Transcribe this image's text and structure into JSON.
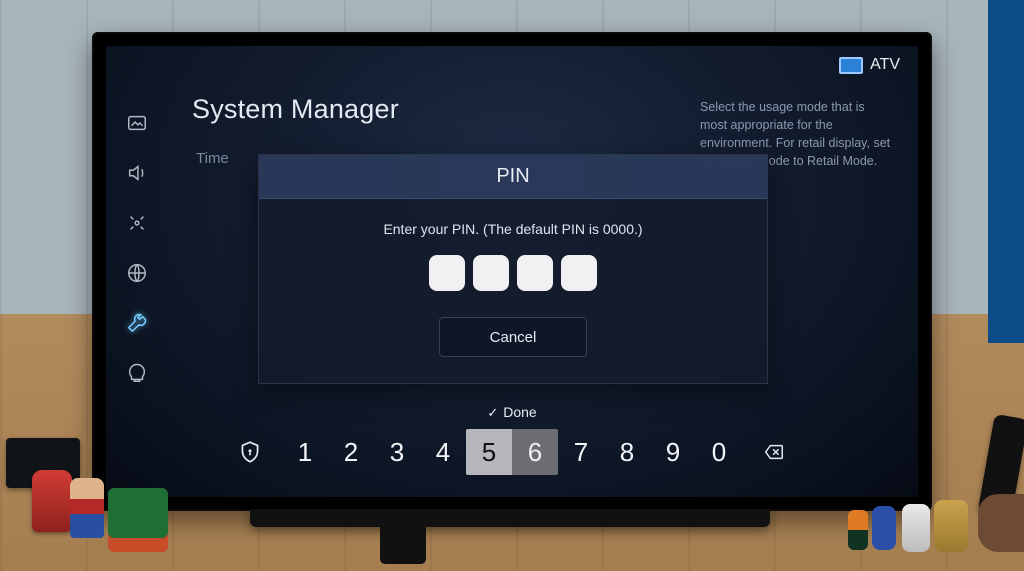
{
  "source_label": "ATV",
  "settings_title": "System Manager",
  "dimmed_item": "Time",
  "help_text": "Select the usage mode that is most appropriate for the environment. For retail display, set the usage mode to Retail Mode.",
  "dialog": {
    "title": "PIN",
    "message": "Enter your PIN. (The default PIN is 0000.)",
    "cancel": "Cancel"
  },
  "done_label": "Done",
  "numpad": {
    "keys": [
      "1",
      "2",
      "3",
      "4",
      "5",
      "6",
      "7",
      "8",
      "9",
      "0"
    ],
    "focused_index": 4,
    "adjacent_index": 5
  },
  "sidebar_icons": [
    {
      "name": "picture-icon"
    },
    {
      "name": "sound-icon"
    },
    {
      "name": "broadcast-icon"
    },
    {
      "name": "network-icon"
    },
    {
      "name": "system-icon",
      "active": true
    },
    {
      "name": "support-icon"
    }
  ]
}
